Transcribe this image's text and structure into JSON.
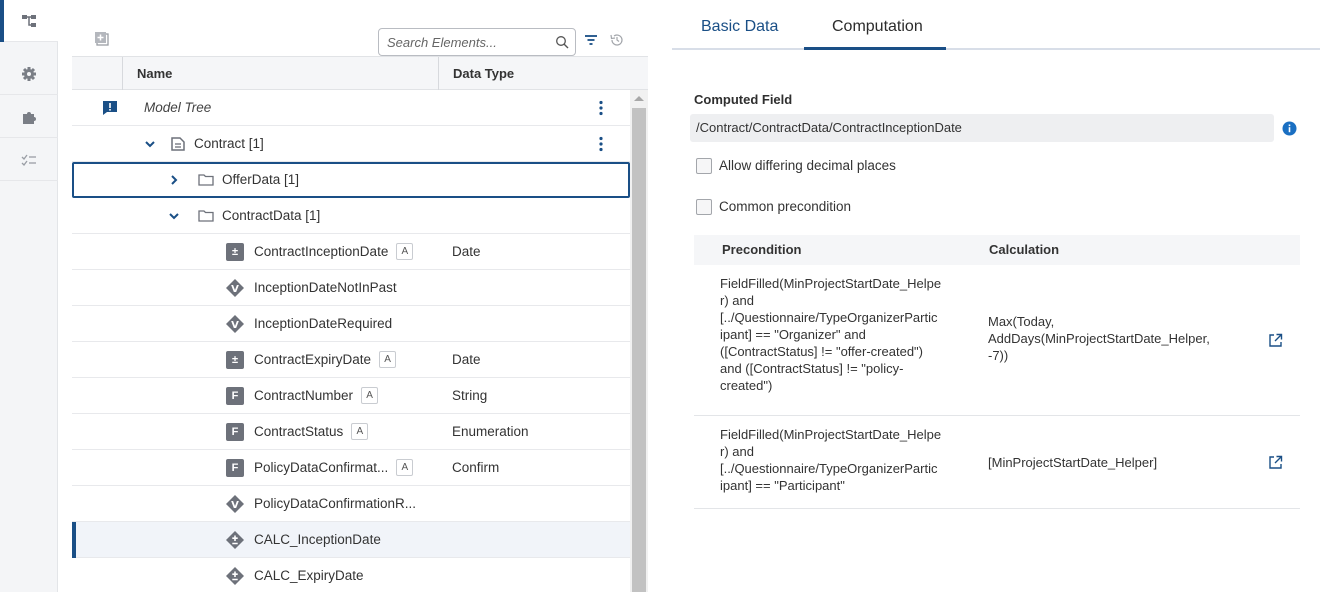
{
  "rail": {
    "items": [
      {
        "icon": "tree-structure-icon",
        "active": true
      },
      {
        "icon": "gear-icon",
        "active": false
      },
      {
        "icon": "puzzle-icon",
        "active": false
      },
      {
        "icon": "checklist-icon",
        "active": false
      }
    ]
  },
  "tree": {
    "search_placeholder": "Search Elements...",
    "columns": {
      "name": "Name",
      "data_type": "Data Type"
    },
    "rows": [
      {
        "label": "Model Tree",
        "data_type": "",
        "badge": ""
      },
      {
        "label": "Contract [1]",
        "data_type": "",
        "badge": ""
      },
      {
        "label": "OfferData [1]",
        "data_type": "",
        "badge": ""
      },
      {
        "label": "ContractData [1]",
        "data_type": "",
        "badge": ""
      },
      {
        "label": "ContractInceptionDate",
        "data_type": "Date",
        "badge": "A"
      },
      {
        "label": "InceptionDateNotInPast",
        "data_type": "",
        "badge": ""
      },
      {
        "label": "InceptionDateRequired",
        "data_type": "",
        "badge": ""
      },
      {
        "label": "ContractExpiryDate",
        "data_type": "Date",
        "badge": "A"
      },
      {
        "label": "ContractNumber",
        "data_type": "String",
        "badge": "A"
      },
      {
        "label": "ContractStatus",
        "data_type": "Enumeration",
        "badge": "A"
      },
      {
        "label": "PolicyDataConfirmat...",
        "data_type": "Confirm",
        "badge": "A"
      },
      {
        "label": "PolicyDataConfirmationR...",
        "data_type": "",
        "badge": ""
      },
      {
        "label": "CALC_InceptionDate",
        "data_type": "",
        "badge": ""
      },
      {
        "label": "CALC_ExpiryDate",
        "data_type": "",
        "badge": ""
      }
    ],
    "field_icon_letter": "F",
    "validation_icon_letter": "V"
  },
  "tabs": {
    "basic": "Basic Data",
    "computation": "Computation"
  },
  "computed_field": {
    "label": "Computed Field",
    "value": "/Contract/ContractData/ContractInceptionDate"
  },
  "options": {
    "allow_decimals": "Allow differing decimal places",
    "common_precondition": "Common precondition"
  },
  "calc_table": {
    "headers": {
      "precondition": "Precondition",
      "calculation": "Calculation"
    },
    "rows": [
      {
        "precondition_lines": [
          "FieldFilled(MinProjectStartDate_Helpe",
          "r) and",
          "[../Questionnaire/TypeOrganizerPartic",
          "ipant] == \"Organizer\" and",
          "([ContractStatus] != \"offer-created\")",
          "and ([ContractStatus] != \"policy-",
          "created\")"
        ],
        "calculation_lines": [
          "Max(Today,",
          "AddDays(MinProjectStartDate_Helper,",
          "-7))"
        ]
      },
      {
        "precondition_lines": [
          "FieldFilled(MinProjectStartDate_Helpe",
          "r) and",
          "[../Questionnaire/TypeOrganizerPartic",
          "ipant] == \"Participant\""
        ],
        "calculation_lines": [
          "[MinProjectStartDate_Helper]"
        ]
      }
    ]
  },
  "colors": {
    "accent": "#1a4f86",
    "icon_gray": "#6d717a"
  }
}
